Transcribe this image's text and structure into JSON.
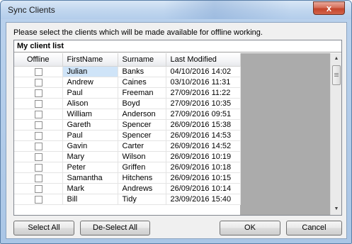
{
  "window": {
    "title": "Sync Clients",
    "close_label": "x"
  },
  "instructions": "Please select the clients which will be made available for offline working.",
  "grid": {
    "caption": "My client list",
    "columns": [
      "Offline",
      "FirstName",
      "Surname",
      "Last Modified"
    ],
    "rows": [
      {
        "offline": false,
        "first": "Julian",
        "surname": "Banks",
        "modified": "04/10/2016 14:02"
      },
      {
        "offline": false,
        "first": "Andrew",
        "surname": "Caines",
        "modified": "03/10/2016 11:31"
      },
      {
        "offline": false,
        "first": "Paul",
        "surname": "Freeman",
        "modified": "27/09/2016 11:22"
      },
      {
        "offline": false,
        "first": "Alison",
        "surname": "Boyd",
        "modified": "27/09/2016 10:35"
      },
      {
        "offline": false,
        "first": "William",
        "surname": "Anderson",
        "modified": "27/09/2016 09:51"
      },
      {
        "offline": false,
        "first": "Gareth",
        "surname": "Spencer",
        "modified": "26/09/2016 15:38"
      },
      {
        "offline": false,
        "first": "Paul",
        "surname": "Spencer",
        "modified": "26/09/2016 14:53"
      },
      {
        "offline": false,
        "first": "Gavin",
        "surname": "Carter",
        "modified": "26/09/2016 14:52"
      },
      {
        "offline": false,
        "first": "Mary",
        "surname": "Wilson",
        "modified": "26/09/2016 10:19"
      },
      {
        "offline": false,
        "first": "Peter",
        "surname": "Griffen",
        "modified": "26/09/2016 10:18"
      },
      {
        "offline": false,
        "first": "Samantha",
        "surname": "Hitchens",
        "modified": "26/09/2016 10:15"
      },
      {
        "offline": false,
        "first": "Mark",
        "surname": "Andrews",
        "modified": "26/09/2016 10:14"
      },
      {
        "offline": false,
        "first": "Bill",
        "surname": "Tidy",
        "modified": "23/09/2016 15:40"
      }
    ]
  },
  "buttons": {
    "select_all": "Select All",
    "deselect_all": "De-Select All",
    "ok": "OK",
    "cancel": "Cancel"
  },
  "colors": {
    "title_bar": "#c2d7ef",
    "close_button": "#c4452c",
    "selected_cell": "#cfe4f8",
    "empty_grid_area": "#ababab"
  },
  "icons": {
    "close": "close-icon",
    "scroll_up": "scroll-up-arrow-icon",
    "scroll_down": "scroll-down-arrow-icon"
  }
}
